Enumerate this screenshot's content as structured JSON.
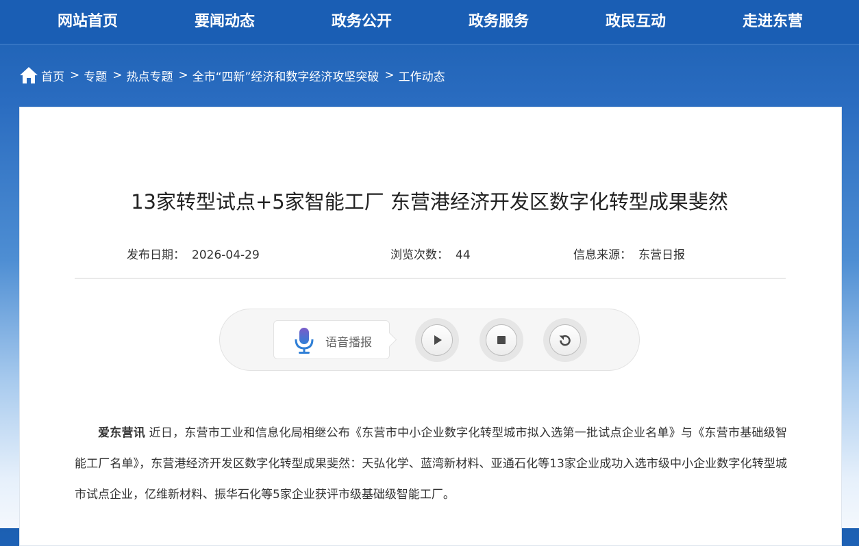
{
  "nav": {
    "items": [
      "网站首页",
      "要闻动态",
      "政务公开",
      "政务服务",
      "政民互动",
      "走进东营"
    ]
  },
  "breadcrumb": {
    "separator": ">",
    "items": [
      "首页",
      "专题",
      "热点专题",
      "全市“四新”经济和数字经济攻坚突破",
      "工作动态"
    ]
  },
  "article": {
    "title": "13家转型试点+5家智能工厂 东营港经济开发区数字化转型成果斐然",
    "meta": {
      "date_label": "发布日期：",
      "date": "2026-04-29",
      "views_label": "浏览次数：",
      "views": "44",
      "source_label": "信息来源：",
      "source": "东营日报"
    },
    "lead": "爱东营讯",
    "body": "近日，东营市工业和信息化局相继公布《东营市中小企业数字化转型城市拟入选第一批试点企业名单》与《东营市基础级智能工厂名单》，东营港经济开发区数字化转型成果斐然：天弘化学、蓝湾新材料、亚通石化等13家企业成功入选市级中小企业数字化转型城市试点企业，亿维新材料、振华石化等5家企业获评市级基础级智能工厂。"
  },
  "player": {
    "label": "语音播报",
    "buttons": [
      "play-icon",
      "stop-icon",
      "replay-icon"
    ]
  },
  "colors": {
    "nav_bg": "#1a5eb4",
    "mic_top": "#7b5cc9",
    "mic_bottom": "#2f7fd6"
  }
}
